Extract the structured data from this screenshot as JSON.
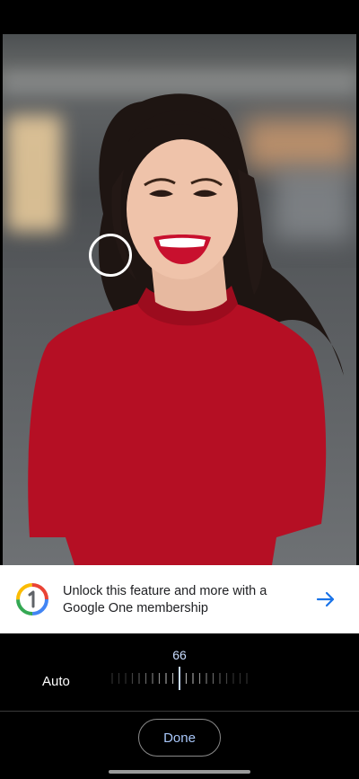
{
  "promo": {
    "text": "Unlock this feature and more with a Google One membership",
    "logo_icon": "google-one-icon",
    "arrow_icon": "arrow-right-icon",
    "arrow_color": "#1a73e8"
  },
  "adjustment": {
    "mode_label": "Auto",
    "value": "66",
    "value_color": "#c9dcff"
  },
  "footer": {
    "done_label": "Done"
  },
  "colors": {
    "background": "#000000",
    "card": "#ffffff",
    "accent": "#a8c7fa"
  }
}
